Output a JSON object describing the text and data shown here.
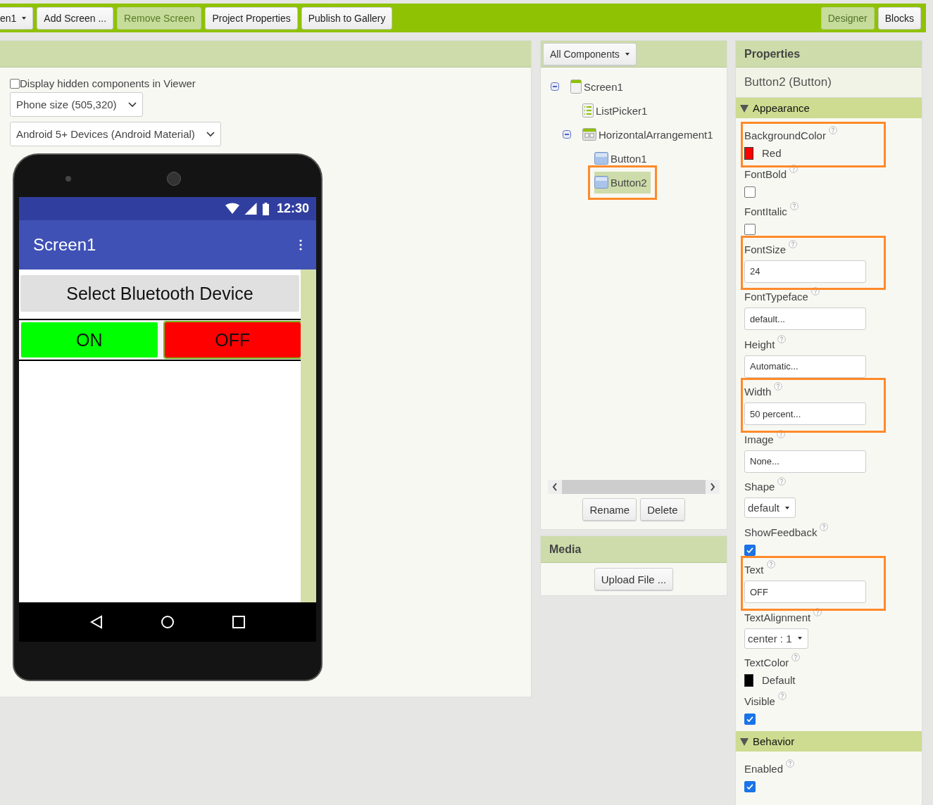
{
  "toolbar": {
    "left": [
      {
        "label": "en1",
        "kind": "dropdown",
        "disabled": false
      },
      {
        "label": "Add Screen ...",
        "kind": "button",
        "disabled": false
      },
      {
        "label": "Remove Screen",
        "kind": "button",
        "disabled": true
      },
      {
        "label": "Project Properties",
        "kind": "button",
        "disabled": false
      },
      {
        "label": "Publish to Gallery",
        "kind": "button",
        "disabled": false
      }
    ],
    "right": [
      {
        "label": "Designer",
        "selected": true
      },
      {
        "label": "Blocks",
        "selected": false
      }
    ]
  },
  "viewer": {
    "hidden_checkbox": {
      "label": "Display hidden components in Viewer",
      "checked": false
    },
    "selects": [
      "Phone size (505,320)",
      "Android 5+ Devices (Android Material)"
    ],
    "phone": {
      "time": "12:30",
      "title": "Screen1",
      "components": [
        {
          "kind": "button",
          "text": "Select Bluetooth Device",
          "color": "#e0e0e0",
          "selected": false
        },
        {
          "kind": "arrangement",
          "children": [
            {
              "kind": "button",
              "text": "ON",
              "color": "#00ff00",
              "selected": false
            },
            {
              "kind": "button",
              "text": "OFF",
              "color": "#ff0000",
              "selected": true
            }
          ]
        }
      ]
    }
  },
  "components": {
    "filter": "All Components",
    "tree": [
      {
        "name": "Screen1",
        "kind": "screen",
        "expanded": true,
        "selected": false,
        "highlighted": false,
        "children": [
          {
            "name": "ListPicker1",
            "kind": "listpicker",
            "selected": false,
            "highlighted": false
          },
          {
            "name": "HorizontalArrangement1",
            "kind": "arrangement",
            "expanded": true,
            "selected": false,
            "highlighted": false,
            "children": [
              {
                "name": "Button1",
                "kind": "button",
                "selected": false,
                "highlighted": false
              },
              {
                "name": "Button2",
                "kind": "button",
                "selected": true,
                "highlighted": true
              }
            ]
          }
        ]
      }
    ],
    "buttons": [
      "Rename",
      "Delete"
    ]
  },
  "media": {
    "title": "Media",
    "button": "Upload File ..."
  },
  "properties": {
    "title": "Properties",
    "component": "Button2 (Button)",
    "sections": [
      {
        "title": "Appearance",
        "expanded": true,
        "properties": [
          {
            "name": "BackgroundColor",
            "kind": "color",
            "color": "#ff0000",
            "value": "Red",
            "highlighted": true
          },
          {
            "name": "FontBold",
            "kind": "checkbox",
            "checked": false,
            "highlighted": false
          },
          {
            "name": "FontItalic",
            "kind": "checkbox",
            "checked": false,
            "highlighted": false
          },
          {
            "name": "FontSize",
            "kind": "text",
            "value": "24",
            "highlighted": true
          },
          {
            "name": "FontTypeface",
            "kind": "text",
            "value": "default...",
            "highlighted": false
          },
          {
            "name": "Height",
            "kind": "text",
            "value": "Automatic...",
            "highlighted": false
          },
          {
            "name": "Width",
            "kind": "text",
            "value": "50 percent...",
            "highlighted": true
          },
          {
            "name": "Image",
            "kind": "text",
            "value": "None...",
            "highlighted": false
          },
          {
            "name": "Shape",
            "kind": "dropdown",
            "value": "default",
            "highlighted": false
          },
          {
            "name": "ShowFeedback",
            "kind": "checkbox",
            "checked": true,
            "highlighted": false
          },
          {
            "name": "Text",
            "kind": "text",
            "value": "OFF",
            "highlighted": true
          },
          {
            "name": "TextAlignment",
            "kind": "dropdown",
            "value": "center : 1",
            "highlighted": false
          },
          {
            "name": "TextColor",
            "kind": "color",
            "color": "#000000",
            "value": "Default",
            "highlighted": false
          },
          {
            "name": "Visible",
            "kind": "checkbox",
            "checked": true,
            "highlighted": false
          }
        ]
      },
      {
        "title": "Behavior",
        "expanded": true,
        "properties": [
          {
            "name": "Enabled",
            "kind": "checkbox",
            "checked": true,
            "highlighted": false
          }
        ]
      }
    ]
  }
}
